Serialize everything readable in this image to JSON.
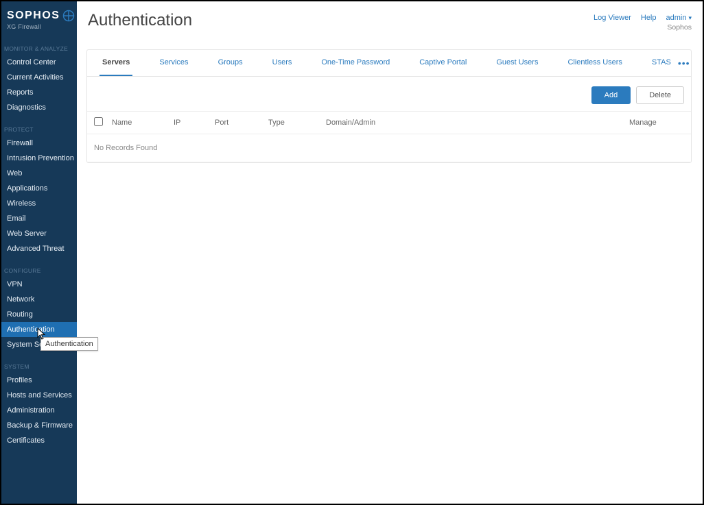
{
  "brand": {
    "name": "SOPHOS",
    "subtitle": "XG Firewall"
  },
  "sidebar": {
    "sections": [
      {
        "title": "MONITOR & ANALYZE",
        "items": [
          "Control Center",
          "Current Activities",
          "Reports",
          "Diagnostics"
        ]
      },
      {
        "title": "PROTECT",
        "items": [
          "Firewall",
          "Intrusion Prevention",
          "Web",
          "Applications",
          "Wireless",
          "Email",
          "Web Server",
          "Advanced Threat"
        ]
      },
      {
        "title": "CONFIGURE",
        "items": [
          "VPN",
          "Network",
          "Routing",
          "Authentication",
          "System Services"
        ],
        "active_index": 3
      },
      {
        "title": "SYSTEM",
        "items": [
          "Profiles",
          "Hosts and Services",
          "Administration",
          "Backup & Firmware",
          "Certificates"
        ]
      }
    ]
  },
  "tooltip": "Authentication",
  "header": {
    "page_title": "Authentication",
    "links": {
      "log_viewer": "Log Viewer",
      "help": "Help",
      "user": "admin",
      "company": "Sophos"
    }
  },
  "tabs": {
    "items": [
      "Servers",
      "Services",
      "Groups",
      "Users",
      "One-Time Password",
      "Captive Portal",
      "Guest Users",
      "Clientless Users",
      "STAS"
    ],
    "active_index": 0,
    "more_label": "•••"
  },
  "actions": {
    "add": "Add",
    "delete": "Delete"
  },
  "table": {
    "columns": {
      "name": "Name",
      "ip": "IP",
      "port": "Port",
      "type": "Type",
      "domain": "Domain/Admin",
      "manage": "Manage"
    },
    "empty": "No Records Found"
  }
}
